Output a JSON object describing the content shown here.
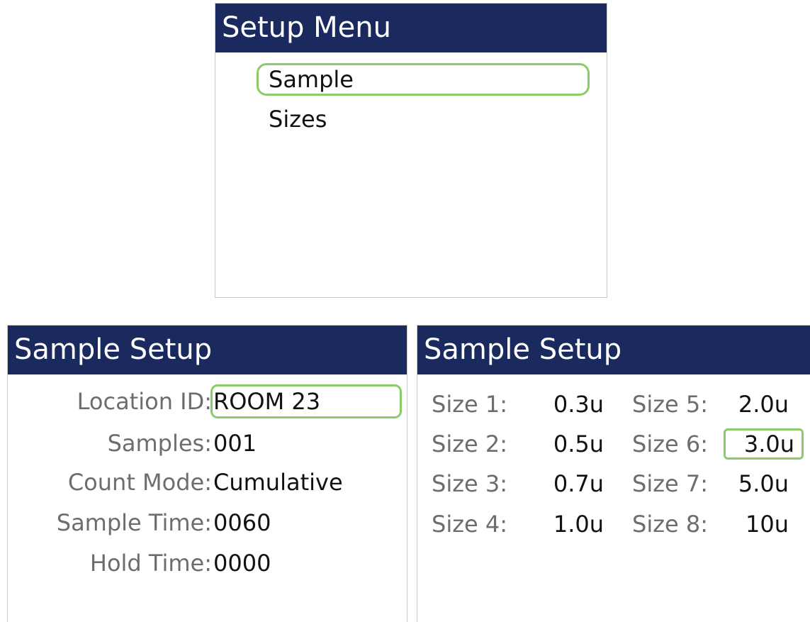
{
  "setup_menu": {
    "title": "Setup Menu",
    "items": [
      {
        "label": "Sample",
        "selected": true
      },
      {
        "label": "Sizes",
        "selected": false
      }
    ]
  },
  "sample_setup": {
    "title": "Sample Setup",
    "fields": [
      {
        "label": "Location ID:",
        "value": "ROOM 23",
        "selected": true
      },
      {
        "label": "Samples:",
        "value": "001",
        "selected": false
      },
      {
        "label": "Count Mode:",
        "value": "Cumulative",
        "selected": false
      },
      {
        "label": "Sample Time:",
        "value": "0060",
        "selected": false
      },
      {
        "label": "Hold Time:",
        "value": "0000",
        "selected": false
      }
    ]
  },
  "sizes_setup": {
    "title": "Sample Setup",
    "sizes": [
      {
        "label": "Size 1:",
        "value": "0.3u",
        "selected": false
      },
      {
        "label": "Size 2:",
        "value": "0.5u",
        "selected": false
      },
      {
        "label": "Size 3:",
        "value": "0.7u",
        "selected": false
      },
      {
        "label": "Size 4:",
        "value": "1.0u",
        "selected": false
      },
      {
        "label": "Size 5:",
        "value": "2.0u",
        "selected": false
      },
      {
        "label": "Size 6:",
        "value": "3.0u",
        "selected": true
      },
      {
        "label": "Size 7:",
        "value": "5.0u",
        "selected": false
      },
      {
        "label": "Size 8:",
        "value": "10u",
        "selected": false
      }
    ]
  },
  "colors": {
    "header_background": "#1b2a5e",
    "header_text": "#ffffff",
    "selection_outline": "#8ccb6a",
    "label_text": "#6d6d6d",
    "value_text": "#111111"
  }
}
